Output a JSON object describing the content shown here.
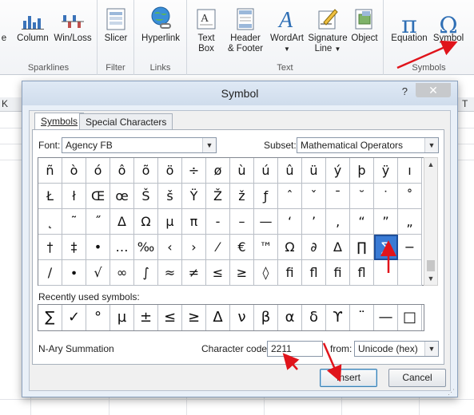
{
  "ribbon": {
    "groups": [
      {
        "name": "Sparklines",
        "buttons": [
          "e",
          "Column",
          "Win/Loss"
        ]
      },
      {
        "name": "Filter",
        "buttons": [
          "Slicer"
        ]
      },
      {
        "name": "Links",
        "buttons": [
          "Hyperlink"
        ]
      },
      {
        "name": "Text",
        "buttons": [
          "Text Box",
          "Header & Footer",
          "WordArt",
          "Signature Line",
          "Object"
        ]
      },
      {
        "name": "Symbols",
        "buttons": [
          "Equation",
          "Symbol"
        ]
      }
    ],
    "textbox_l1": "Text",
    "textbox_l2": "Box",
    "header_l1": "Header",
    "header_l2": "& Footer",
    "wordart": "WordArt",
    "sig_l1": "Signature",
    "sig_l2": "Line",
    "object": "Object",
    "equation": "Equation",
    "symbol": "Symbol",
    "equation_glyph": "π",
    "symbol_glyph": "Ω"
  },
  "sheet": {
    "col_left": "K",
    "col_right": "T"
  },
  "dialog": {
    "title": "Symbol",
    "help": "?",
    "close": "✕",
    "tabs": [
      "Symbols",
      "Special Characters"
    ],
    "font_label": "Font:",
    "font_value": "Agency FB",
    "subset_label": "Subset:",
    "subset_value": "Mathematical Operators",
    "grid_rows": [
      [
        "ñ",
        "ò",
        "ó",
        "ô",
        "õ",
        "ö",
        "÷",
        "ø",
        "ù",
        "ú",
        "û",
        "ü",
        "ý",
        "þ",
        "ÿ",
        "ı"
      ],
      [
        "Ł",
        "ł",
        "Œ",
        "œ",
        "Š",
        "š",
        "Ÿ",
        "Ž",
        "ž",
        "ƒ",
        "ˆ",
        "ˇ",
        "ˉ",
        "˘",
        "˙",
        "˚"
      ],
      [
        "˛",
        "˜",
        "˝",
        "Δ",
        "Ω",
        "μ",
        "π",
        "‐",
        "–",
        "—",
        "‘",
        "’",
        "‚",
        "“",
        "”",
        "„"
      ],
      [
        "†",
        "‡",
        "•",
        "…",
        "‰",
        "‹",
        "›",
        "⁄",
        "€",
        "™",
        "Ω",
        "∂",
        "∆",
        "∏",
        "∑",
        "−"
      ],
      [
        "∕",
        "∙",
        "√",
        "∞",
        "∫",
        "≈",
        "≠",
        "≤",
        "≥",
        "◊",
        "ﬁ",
        "ﬂ",
        "ﬁ",
        "ﬂ",
        "",
        ""
      ]
    ],
    "selected_index": {
      "row": 3,
      "col": 14
    },
    "recent_label": "Recently used symbols:",
    "recent": [
      "∑",
      "✓",
      "°",
      "µ",
      "±",
      "≤",
      "≥",
      "Δ",
      "ν",
      "β",
      "α",
      "δ",
      "ϒ",
      "¨",
      "—",
      "□"
    ],
    "char_name": "N-Ary Summation",
    "char_code_label": "Character code:",
    "char_code_value": "2211",
    "from_label": "from:",
    "from_value": "Unicode (hex)",
    "insert": "Insert",
    "cancel": "Cancel"
  },
  "colors": {
    "accent": "#2b5797",
    "selection": "#3a7bd5",
    "annotation_arrow": "#e0141b"
  }
}
